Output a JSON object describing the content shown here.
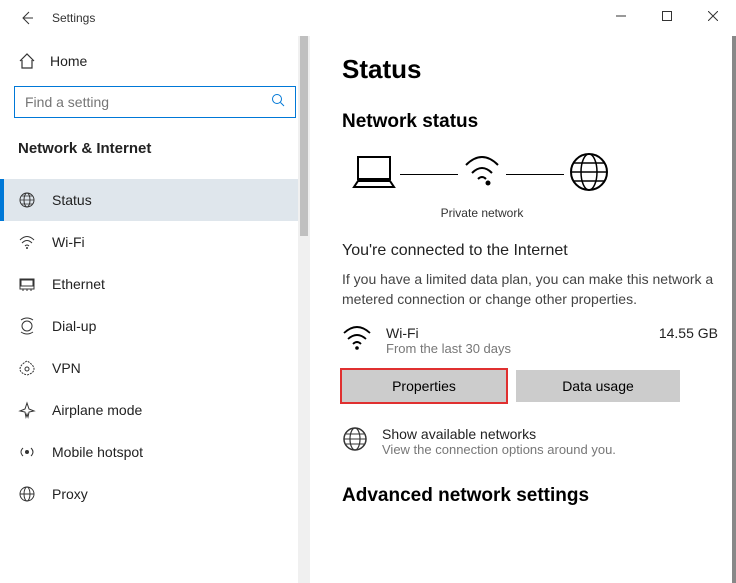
{
  "window": {
    "title": "Settings"
  },
  "sidebar": {
    "home": "Home",
    "search_placeholder": "Find a setting",
    "section": "Network & Internet",
    "items": [
      {
        "label": "Status"
      },
      {
        "label": "Wi-Fi"
      },
      {
        "label": "Ethernet"
      },
      {
        "label": "Dial-up"
      },
      {
        "label": "VPN"
      },
      {
        "label": "Airplane mode"
      },
      {
        "label": "Mobile hotspot"
      },
      {
        "label": "Proxy"
      }
    ]
  },
  "main": {
    "page_title": "Status",
    "section_title": "Network status",
    "diagram_caption": "Private network",
    "connected_title": "You're connected to the Internet",
    "connected_desc": "If you have a limited data plan, you can make this network a metered connection or change other properties.",
    "wifi": {
      "name": "Wi-Fi",
      "sub": "From the last 30 days",
      "usage": "14.55 GB"
    },
    "buttons": {
      "properties": "Properties",
      "data_usage": "Data usage"
    },
    "available": {
      "title": "Show available networks",
      "sub": "View the connection options around you."
    },
    "advanced_title": "Advanced network settings"
  }
}
